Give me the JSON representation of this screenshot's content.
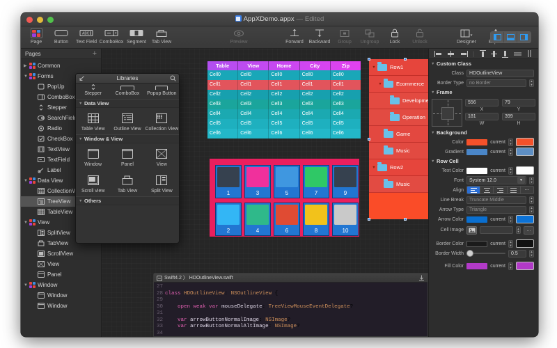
{
  "window": {
    "title": "AppXDemo.appx",
    "edited_suffix": "— Edited"
  },
  "toolbar": {
    "left_items": [
      {
        "label": "Page",
        "icon": "page-icon"
      },
      {
        "label": "Button",
        "icon": "button-icon"
      },
      {
        "label": "Text Field",
        "icon": "textfield-icon"
      },
      {
        "label": "ComboBox",
        "icon": "combobox-icon"
      },
      {
        "label": "Segment",
        "icon": "segment-icon"
      },
      {
        "label": "Tab View",
        "icon": "tabview-icon"
      }
    ],
    "center_items": [
      {
        "label": "Preview",
        "icon": "preview-icon",
        "enabled": false
      }
    ],
    "right_items": [
      {
        "label": "Forward",
        "icon": "align-forward-icon",
        "enabled": true
      },
      {
        "label": "Backward",
        "icon": "align-backward-icon",
        "enabled": true
      },
      {
        "label": "Group",
        "icon": "group-icon",
        "enabled": false
      },
      {
        "label": "Ungroup",
        "icon": "ungroup-icon",
        "enabled": false
      },
      {
        "label": "Lock",
        "icon": "lock-closed-icon",
        "enabled": true
      },
      {
        "label": "Unlock",
        "icon": "lock-open-icon",
        "enabled": false
      },
      {
        "label": "Designer",
        "icon": "designer-icon",
        "enabled": true
      },
      {
        "label": "Export",
        "icon": "export-icon",
        "enabled": true
      }
    ],
    "view_modes": [
      "left-panel-icon",
      "bottom-panel-icon",
      "right-panel-icon"
    ]
  },
  "sidebar": {
    "header": "Pages",
    "add_label": "+",
    "items": [
      {
        "label": "Common",
        "level": 1,
        "tri": "▶",
        "icon": "group-swatch-icon",
        "selected": false
      },
      {
        "label": "Forms",
        "level": 1,
        "tri": "▼",
        "icon": "group-swatch-icon",
        "selected": false
      },
      {
        "label": "PopUp",
        "level": 2,
        "tri": "",
        "icon": "popup-icon",
        "selected": false
      },
      {
        "label": "ComboBox",
        "level": 2,
        "tri": "",
        "icon": "combobox-icon",
        "selected": false
      },
      {
        "label": "Stepper",
        "level": 2,
        "tri": "",
        "icon": "stepper-icon",
        "selected": false
      },
      {
        "label": "SearchField",
        "level": 2,
        "tri": "",
        "icon": "searchfield-icon",
        "selected": false
      },
      {
        "label": "Radio",
        "level": 2,
        "tri": "",
        "icon": "radio-icon",
        "selected": false
      },
      {
        "label": "CheckBox",
        "level": 2,
        "tri": "",
        "icon": "checkbox-icon",
        "selected": false
      },
      {
        "label": "TextView",
        "level": 2,
        "tri": "",
        "icon": "textview-icon",
        "selected": false
      },
      {
        "label": "TextField",
        "level": 2,
        "tri": "",
        "icon": "textfield-icon",
        "selected": false
      },
      {
        "label": "Label",
        "level": 2,
        "tri": "",
        "icon": "label-icon",
        "selected": false
      },
      {
        "label": "Data View",
        "level": 1,
        "tri": "▼",
        "icon": "group-swatch-icon",
        "selected": false
      },
      {
        "label": "CollectionView",
        "level": 2,
        "tri": "",
        "icon": "collectionview-icon",
        "selected": false
      },
      {
        "label": "TreeView",
        "level": 2,
        "tri": "",
        "icon": "treeview-icon",
        "selected": true
      },
      {
        "label": "TableView",
        "level": 2,
        "tri": "",
        "icon": "tableview-icon",
        "selected": false
      },
      {
        "label": "View",
        "level": 1,
        "tri": "▼",
        "icon": "group-swatch-icon",
        "selected": false
      },
      {
        "label": "SplitView",
        "level": 2,
        "tri": "",
        "icon": "splitview-icon",
        "selected": false
      },
      {
        "label": "TabView",
        "level": 2,
        "tri": "",
        "icon": "tabview-icon",
        "selected": false
      },
      {
        "label": "ScrollView",
        "level": 2,
        "tri": "",
        "icon": "scrollview-icon",
        "selected": false
      },
      {
        "label": "View",
        "level": 2,
        "tri": "",
        "icon": "view-icon",
        "selected": false
      },
      {
        "label": "Panel",
        "level": 2,
        "tri": "",
        "icon": "panel-icon",
        "selected": false
      },
      {
        "label": "Window",
        "level": 1,
        "tri": "▼",
        "icon": "group-swatch-icon",
        "selected": false
      },
      {
        "label": "Window",
        "level": 2,
        "tri": "",
        "icon": "window-icon",
        "selected": false
      },
      {
        "label": "Window",
        "level": 2,
        "tri": "",
        "icon": "window-icon",
        "selected": false
      }
    ]
  },
  "libraries": {
    "title": "Libraries",
    "collapse_icon": "collapse-icon",
    "search_icon": "search-icon",
    "top_partial": [
      "Stepper",
      "ComboBox",
      "Popup Button"
    ],
    "sections": [
      {
        "title": "Data View",
        "items": [
          {
            "label": "Table View",
            "icon": "tableview-icon"
          },
          {
            "label": "Outline View",
            "icon": "outlineview-icon"
          },
          {
            "label": "Collection View",
            "icon": "collectionview-icon"
          }
        ]
      },
      {
        "title": "Window & View",
        "items": [
          {
            "label": "Window",
            "icon": "window-icon"
          },
          {
            "label": "Panel",
            "icon": "panel-icon"
          },
          {
            "label": "View",
            "icon": "view-icon"
          },
          {
            "label": "Scroll view",
            "icon": "scrollview-icon"
          },
          {
            "label": "Tab View",
            "icon": "tabview-icon"
          },
          {
            "label": "Split View",
            "icon": "splitview-icon"
          }
        ]
      },
      {
        "title": "Others",
        "items": []
      }
    ]
  },
  "canvas": {
    "table_widget": {
      "headers": [
        "Table",
        "View",
        "Home",
        "City",
        "Zip"
      ],
      "rows": [
        {
          "cells": [
            "Cell0",
            "Cell0",
            "Cell0",
            "Cell0",
            "Cell0"
          ],
          "color": "#19a7b8"
        },
        {
          "cells": [
            "Cell1",
            "Cell1",
            "Cell1",
            "Cell1",
            "Cell1"
          ],
          "color": "#e2545c"
        },
        {
          "cells": [
            "Cell2",
            "Cell2",
            "Cell2",
            "Cell2",
            "Cell2"
          ],
          "color": "#17a0ae"
        },
        {
          "cells": [
            "Cell3",
            "Cell3",
            "Cell3",
            "Cell3",
            "Cell3"
          ],
          "color": "#1aa59c"
        },
        {
          "cells": [
            "Cell4",
            "Cell4",
            "Cell4",
            "Cell4",
            "Cell4"
          ],
          "color": "#1ba9b1"
        },
        {
          "cells": [
            "Cell5",
            "Cell5",
            "Cell5",
            "Cell5",
            "Cell5"
          ],
          "color": "#1eb0bf"
        },
        {
          "cells": [
            "Cell6",
            "Cell6",
            "Cell6",
            "Cell6",
            "Cell6"
          ],
          "color": "#23b8c9"
        }
      ],
      "header_gradient_from": "#b14ff0",
      "header_gradient_to": "#e341f0"
    },
    "collection_widget": {
      "background": "#ea1f5e",
      "cell_background": "#2276d2",
      "cells": [
        {
          "number": "1",
          "swatch": "#36414f"
        },
        {
          "number": "3",
          "swatch": "#f0309c"
        },
        {
          "number": "5",
          "swatch": "#3f97e0"
        },
        {
          "number": "7",
          "swatch": "#2fc866"
        },
        {
          "number": "9",
          "swatch": "#36414f"
        },
        {
          "number": "2",
          "swatch": "#33b6f5"
        },
        {
          "number": "4",
          "swatch": "#2fb98a"
        },
        {
          "number": "6",
          "swatch": "#e04b33"
        },
        {
          "number": "8",
          "swatch": "#f2c21b"
        },
        {
          "number": "10",
          "swatch": "#c9c9c9"
        }
      ]
    },
    "outline_widget": {
      "background": "#fa4c28",
      "rows": [
        {
          "label": "Row1",
          "indent": 0,
          "tri": "▼"
        },
        {
          "label": "Ecommerce",
          "indent": 1,
          "tri": "▼"
        },
        {
          "label": "Development",
          "indent": 2,
          "tri": ""
        },
        {
          "label": "Operation",
          "indent": 2,
          "tri": ""
        },
        {
          "label": "Game",
          "indent": 1,
          "tri": ""
        },
        {
          "label": "Music",
          "indent": 1,
          "tri": ""
        },
        {
          "label": "Row2",
          "indent": 0,
          "tri": "▼"
        },
        {
          "label": "Music",
          "indent": 1,
          "tri": ""
        }
      ]
    }
  },
  "editor": {
    "breadcrumb_icon": "file-icon",
    "breadcrumb": "Swift4.2  〉 HDOutlineView.swift",
    "download_icon": "download-icon",
    "lines": [
      {
        "no": "27",
        "text": ""
      },
      {
        "no": "28",
        "text": "class HDOutlineView: NSOutlineView {"
      },
      {
        "no": "29",
        "text": ""
      },
      {
        "no": "30",
        "text": "    open weak var mouseDelegate: TreeViewMouseEventDelegate?"
      },
      {
        "no": "31",
        "text": ""
      },
      {
        "no": "32",
        "text": "    var arrowButtonNormalImage: NSImage?"
      },
      {
        "no": "33",
        "text": "    var arrowButtonNormalAltImage: NSImage?"
      },
      {
        "no": "34",
        "text": ""
      }
    ]
  },
  "inspector": {
    "align_icons": [
      "align-left-icon",
      "align-center-h-icon",
      "align-right-icon",
      "align-top-icon",
      "align-middle-v-icon",
      "align-bottom-icon",
      "distribute-h-icon",
      "distribute-v-icon"
    ],
    "custom_class": {
      "title": "Custom Class",
      "class_label": "Class",
      "class_value": "HDOutlineView",
      "border_type_label": "Border Type",
      "border_type_value": "no Border"
    },
    "frame": {
      "title": "Frame",
      "x_value": "556",
      "x_label": "X",
      "y_value": "79",
      "y_label": "Y",
      "w_value": "181",
      "w_label": "W",
      "h_value": "399",
      "h_label": "H"
    },
    "background": {
      "title": "Background",
      "color_label": "Color",
      "color_value": "current",
      "color_bar": "#f5512a",
      "color_swatch": "#f5512a",
      "gradient_label": "Gradient",
      "gradient_value": "current",
      "gradient_bar": "#4a86c8",
      "gradient_swatch": "#5e8fc4"
    },
    "row_cell": {
      "title": "Row Cell",
      "text_color_label": "Text Color",
      "text_color_value": "current",
      "text_color_bar": "#ffffff",
      "text_color_swatch": "#ffffff",
      "font_label": "Font",
      "font_value": "System  12.0",
      "align_label": "Align",
      "align_options": [
        "align-left-icon",
        "align-center-icon",
        "align-right-icon",
        "align-justify-icon",
        "align-more-icon"
      ],
      "align_selected": 0,
      "line_break_label": "Line Break",
      "line_break_value": "Truncate Middle",
      "arrow_type_label": "Arrow Type",
      "arrow_type_value": "Triangle",
      "arrow_color_label": "Arrow Color",
      "arrow_color_value": "current",
      "arrow_color_bar": "#0a6fd0",
      "arrow_color_swatch": "#0c72d6",
      "cell_image_label": "Cell Image",
      "cell_image_icon": "image-icon",
      "cell_image_value": "",
      "cell_image_more": "...",
      "border_color_label": "Border Color",
      "border_color_value": "current",
      "border_color_bar": "#1b1b1b",
      "border_color_swatch": "#111111",
      "border_width_label": "Border Width",
      "border_width_value": "0.5",
      "fill_color_label": "Fill Color",
      "fill_color_value": "current",
      "fill_color_bar": "#b23ac8",
      "fill_color_swatch": "#b23ac8"
    }
  }
}
